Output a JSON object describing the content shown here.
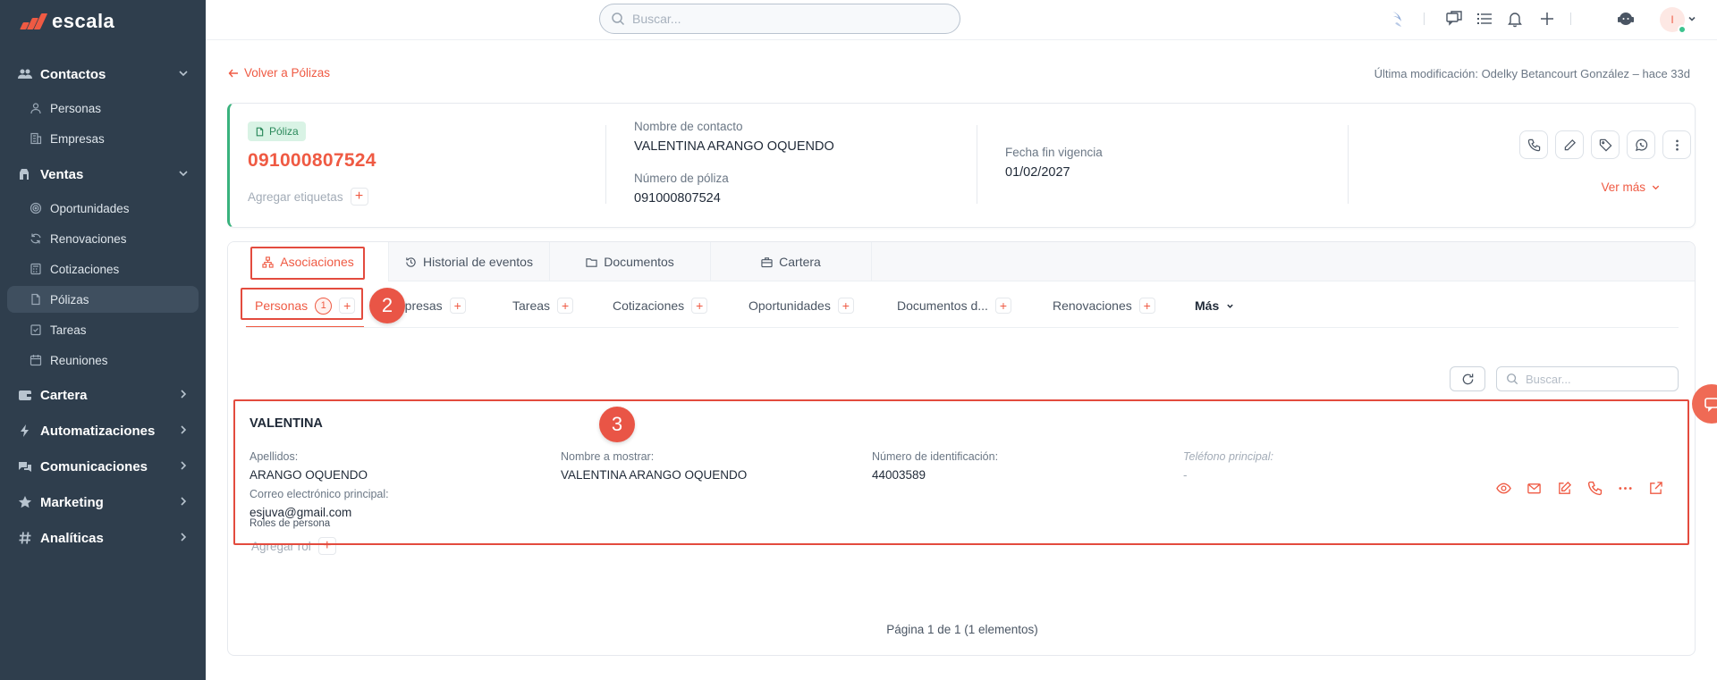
{
  "brand": {
    "name": "escala"
  },
  "sidebar": {
    "groups": [
      {
        "label": "Contactos",
        "icon": "users-icon",
        "expanded": true,
        "items": [
          {
            "label": "Personas",
            "icon": "person-icon"
          },
          {
            "label": "Empresas",
            "icon": "building-icon"
          }
        ]
      },
      {
        "label": "Ventas",
        "icon": "ventas-icon",
        "expanded": true,
        "items": [
          {
            "label": "Oportunidades",
            "icon": "target-icon"
          },
          {
            "label": "Renovaciones",
            "icon": "refresh-icon"
          },
          {
            "label": "Cotizaciones",
            "icon": "calculator-icon"
          },
          {
            "label": "Pólizas",
            "icon": "document-icon",
            "active": true
          },
          {
            "label": "Tareas",
            "icon": "task-icon"
          },
          {
            "label": "Reuniones",
            "icon": "calendar-icon"
          }
        ]
      },
      {
        "label": "Cartera",
        "icon": "wallet-icon",
        "expanded": false
      },
      {
        "label": "Automatizaciones",
        "icon": "lightning-icon",
        "expanded": false
      },
      {
        "label": "Comunicaciones",
        "icon": "chat-icon",
        "expanded": false
      },
      {
        "label": "Marketing",
        "icon": "star-icon",
        "expanded": false
      },
      {
        "label": "Analíticas",
        "icon": "hash-icon",
        "expanded": false
      }
    ]
  },
  "topbar": {
    "search_placeholder": "Buscar...",
    "avatar_initial": "I"
  },
  "page": {
    "back_label": "Volver a Pólizas",
    "last_modified": "Última modificación: Odelky Betancourt González – hace 33d"
  },
  "record": {
    "badge": "Póliza",
    "policy_number": "091000807524",
    "add_tags_label": "Agregar etiquetas",
    "contact_label": "Nombre de contacto",
    "contact_value": "VALENTINA ARANGO OQUENDO",
    "policy_label": "Número de póliza",
    "policy_value": "091000807524",
    "end_date_label": "Fecha fin vigencia",
    "end_date_value": "01/02/2027",
    "ver_mas": "Ver más"
  },
  "tabs": [
    {
      "label": "Asociaciones",
      "icon": "sitemap-icon",
      "active": true
    },
    {
      "label": "Historial de eventos",
      "icon": "history-icon"
    },
    {
      "label": "Documentos",
      "icon": "folder-icon"
    },
    {
      "label": "Cartera",
      "icon": "briefcase-icon"
    }
  ],
  "subtabs": {
    "personas": {
      "label": "Personas",
      "count": "1"
    },
    "empresas": "Empresas",
    "empresas_visible": "mpresas",
    "tareas": "Tareas",
    "cotizaciones": "Cotizaciones",
    "oportunidades": "Oportunidades",
    "documentos": "Documentos d...",
    "renovaciones": "Renovaciones",
    "mas": "Más"
  },
  "steps": {
    "two": "2",
    "three": "3"
  },
  "list": {
    "search_placeholder": "Buscar...",
    "pager": "Página 1 de 1 (1 elementos)"
  },
  "person": {
    "name": "VALENTINA",
    "apellidos_label": "Apellidos:",
    "apellidos_value": "ARANGO OQUENDO",
    "display_label": "Nombre a mostrar:",
    "display_value": "VALENTINA ARANGO OQUENDO",
    "id_label": "Número de identificación:",
    "id_value": "44003589",
    "phone_label": "Teléfono principal:",
    "phone_value": "-",
    "email_label": "Correo electrónico principal:",
    "email_value": "esjuva@gmail.com",
    "roles_label": "Roles de persona",
    "add_role": "Agregar rol"
  },
  "colors": {
    "accent": "#ef5a43",
    "sidebar": "#2f3e4d",
    "success": "#39b27d",
    "highlight": "#e34b3e"
  }
}
